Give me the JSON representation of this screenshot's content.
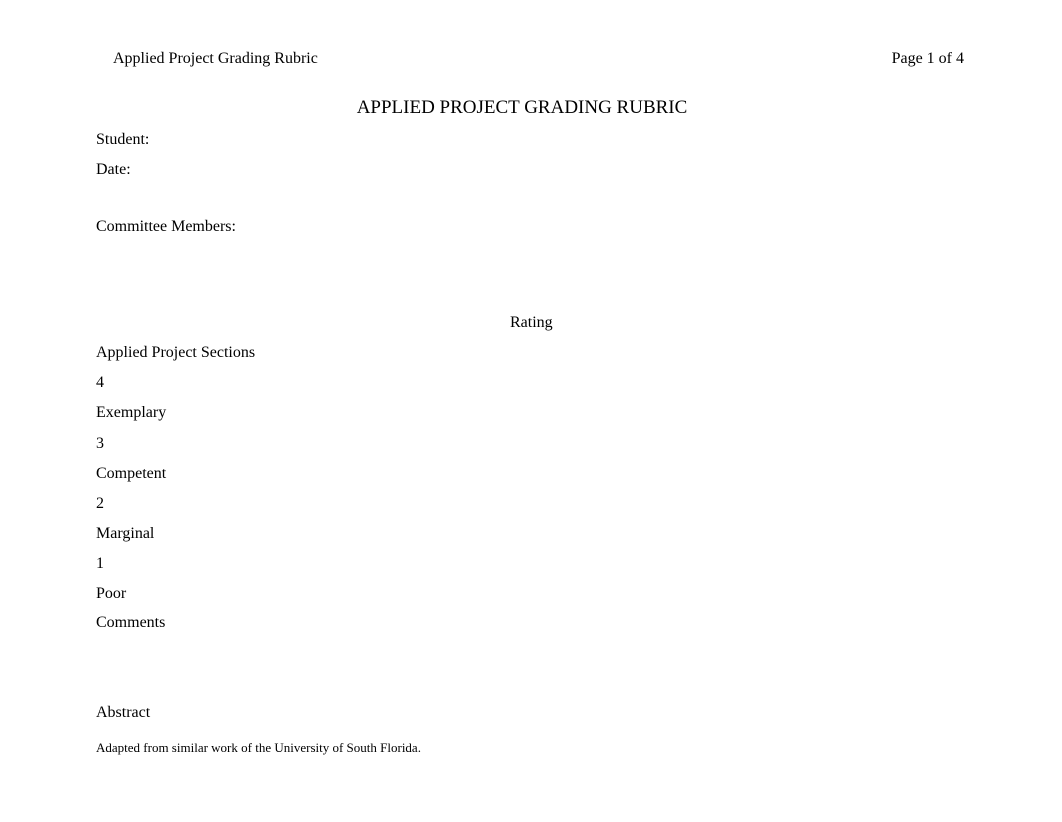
{
  "header": {
    "left": "Applied Project Grading Rubric",
    "right": "Page 1 of 4"
  },
  "title": "APPLIED PROJECT GRADING RUBRIC",
  "fields": {
    "student": "Student:",
    "date": "Date:",
    "committee": "Committee Members:"
  },
  "rating": {
    "heading": "Rating",
    "sections": "Applied Project Sections",
    "levels": [
      {
        "number": "4",
        "label": "Exemplary"
      },
      {
        "number": "3",
        "label": "Competent"
      },
      {
        "number": "2",
        "label": "Marginal"
      },
      {
        "number": "1",
        "label": "Poor"
      }
    ],
    "comments": "Comments"
  },
  "section": {
    "abstract": "Abstract"
  },
  "footnote": "Adapted from similar work of the University of South Florida."
}
